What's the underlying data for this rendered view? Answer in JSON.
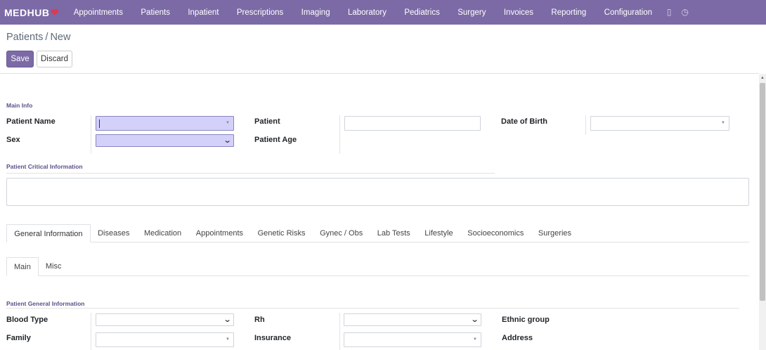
{
  "brand": {
    "name": "MEDHUB",
    "icon": "heart-icon"
  },
  "menu": [
    "Appointments",
    "Patients",
    "Inpatient",
    "Prescriptions",
    "Imaging",
    "Laboratory",
    "Pediatrics",
    "Surgery",
    "Invoices",
    "Reporting",
    "Configuration"
  ],
  "systray": {
    "chat_icon": "chat-icon",
    "activity_icon": "clock-icon"
  },
  "breadcrumb": {
    "parent": "Patients",
    "separator": "/",
    "current": "New"
  },
  "buttons": {
    "save": "Save",
    "discard": "Discard"
  },
  "main_info": {
    "title": "Main Info",
    "patient_name_label": "Patient Name",
    "sex_label": "Sex",
    "patient_label": "Patient",
    "patient_age_label": "Patient Age",
    "dob_label": "Date of Birth",
    "patient_name_value": "",
    "sex_value": "",
    "patient_value": "",
    "dob_value": ""
  },
  "critical": {
    "title": "Patient Critical Information",
    "value": ""
  },
  "tabs": [
    "General Information",
    "Diseases",
    "Medication",
    "Appointments",
    "Genetic Risks",
    "Gynec / Obs",
    "Lab Tests",
    "Lifestyle",
    "Socioeconomics",
    "Surgeries"
  ],
  "active_tab": "General Information",
  "subtabs": [
    "Main",
    "Misc"
  ],
  "active_subtab": "Main",
  "general": {
    "title": "Patient General Information",
    "blood_type_label": "Blood Type",
    "family_label": "Family",
    "rh_label": "Rh",
    "insurance_label": "Insurance",
    "ethnic_label": "Ethnic group",
    "address_label": "Address"
  },
  "colors": {
    "navbar": "#7c6aa6",
    "required_field": "#d3d0fa",
    "section_title": "#5d4f8a"
  }
}
